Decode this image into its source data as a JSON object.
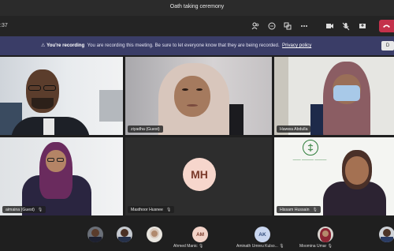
{
  "window": {
    "title": "Oath taking ceremony"
  },
  "toolbar": {
    "timer": ":37",
    "icons": [
      "participants-icon",
      "chat-icon",
      "share-icon",
      "more-icon",
      "camera-icon",
      "mic-off-icon",
      "share-tray-icon",
      "hangup-icon"
    ]
  },
  "banner": {
    "heading": "You're recording",
    "message": "You are recording this meeting. Be sure to let everyone know that they are being recorded.",
    "link": "Privacy policy",
    "button": "D"
  },
  "tiles": [
    {
      "label": ""
    },
    {
      "label": "ziyadha (Guest)"
    },
    {
      "label": "Hawwa Abdulla"
    },
    {
      "label": "aimaina (Guest)"
    },
    {
      "label": "Masthoor Husnee",
      "initials": "MH"
    },
    {
      "label": "Hissam Hussain"
    }
  ],
  "logo": {
    "script_text": "ޖުޑީޝަލް ސަރވިސް ކޮމިޝަން"
  },
  "strip": [
    {
      "name": "",
      "type": "photo"
    },
    {
      "name": "",
      "type": "photo"
    },
    {
      "name": "",
      "type": "photo"
    },
    {
      "name": "Ahmed Manic",
      "initials": "AM"
    },
    {
      "name": "Aminath Umreu Kulso...",
      "initials": "AK"
    },
    {
      "name": "Moomina Umar",
      "type": "photo"
    },
    {
      "name": "",
      "type": "photo"
    }
  ],
  "colors": {
    "accent": "#3a3d67",
    "leave": "#c4314b",
    "avatar_mh": "#f6d6cc",
    "avatar_am": "#f2d3c8",
    "avatar_ak": "#c9d6ef"
  }
}
